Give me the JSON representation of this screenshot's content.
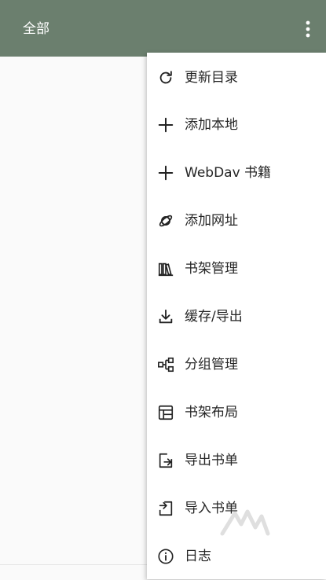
{
  "toolbar": {
    "title": "全部",
    "more_icon": "more-vert-icon",
    "background": "#6b7f6e"
  },
  "menu": {
    "items": [
      {
        "label": "更新目录",
        "icon": "refresh-icon"
      },
      {
        "label": "添加本地",
        "icon": "plus-icon"
      },
      {
        "label": "WebDav 书籍",
        "icon": "plus-icon"
      },
      {
        "label": "添加网址",
        "icon": "planet-icon"
      },
      {
        "label": "书架管理",
        "icon": "bookshelf-icon"
      },
      {
        "label": "缓存/导出",
        "icon": "download-icon"
      },
      {
        "label": "分组管理",
        "icon": "group-tree-icon"
      },
      {
        "label": "书架布局",
        "icon": "layout-icon"
      },
      {
        "label": "导出书单",
        "icon": "export-icon"
      },
      {
        "label": "导入书单",
        "icon": "import-icon"
      },
      {
        "label": "日志",
        "icon": "info-icon"
      }
    ]
  }
}
